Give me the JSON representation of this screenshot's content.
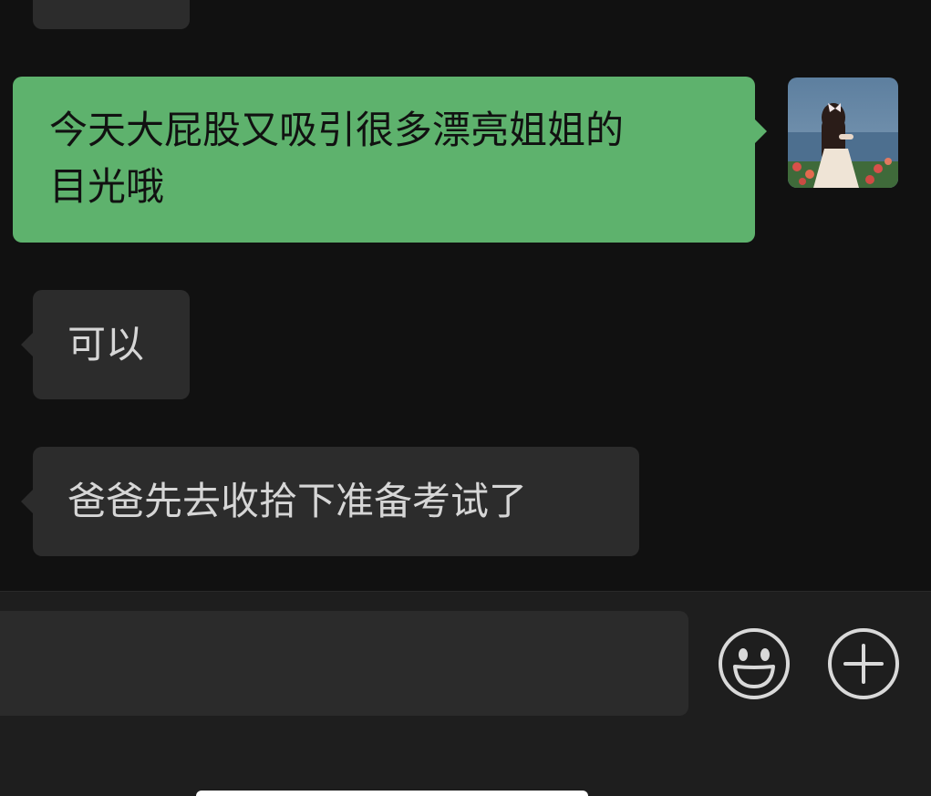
{
  "messages": [
    {
      "side": "out",
      "text_line1": "今天大屁股又吸引很多漂亮姐姐的",
      "text_line2": "目光哦"
    },
    {
      "side": "in",
      "text": "可以"
    },
    {
      "side": "in",
      "text": "爸爸先去收拾下准备考试了"
    }
  ],
  "input": {
    "value": "",
    "placeholder": ""
  },
  "icons": {
    "emoji": "smiley-face-icon",
    "plus": "plus-circle-icon"
  },
  "colors": {
    "background": "#111111",
    "incoming_bubble": "#2c2c2c",
    "outgoing_bubble": "#5eb26d",
    "input_bar": "#1e1e1e"
  }
}
